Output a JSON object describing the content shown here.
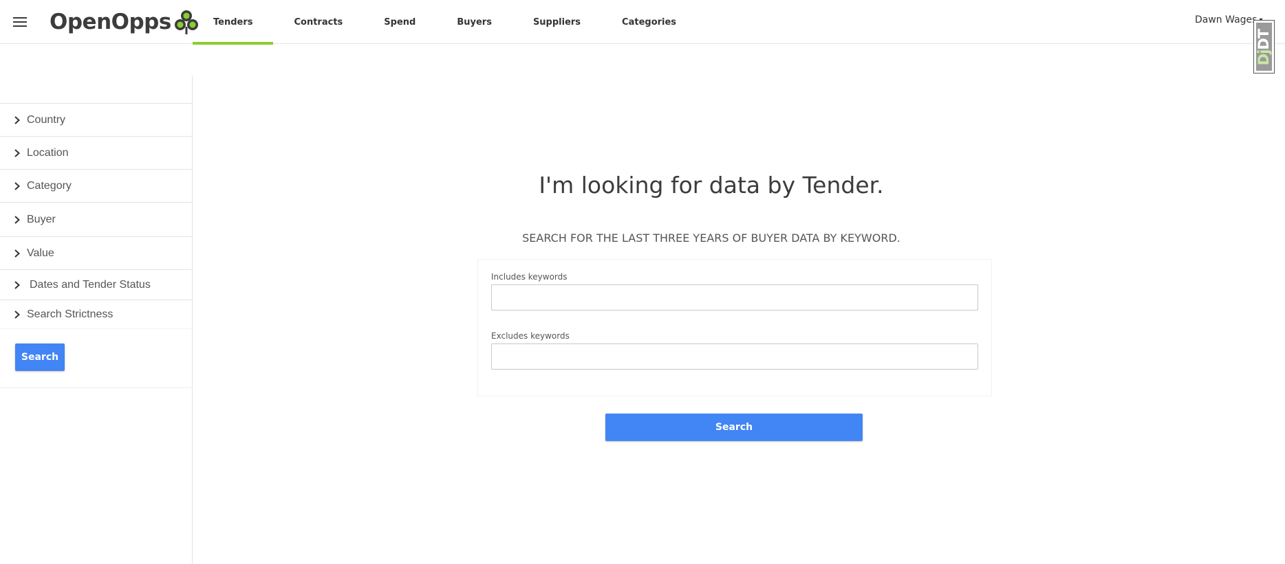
{
  "header": {
    "menu_icon": "hamburger-menu-icon",
    "logo_text": "OpenOpps",
    "logo_icon": "clover-logo-icon",
    "logo_colors": {
      "dark": "#3c3c3c",
      "green": "#8ccd2e"
    },
    "tabs": [
      {
        "label": "Tenders",
        "active": true
      },
      {
        "label": "Contracts",
        "active": false
      },
      {
        "label": "Spend",
        "active": false
      },
      {
        "label": "Buyers",
        "active": false
      },
      {
        "label": "Suppliers",
        "active": false
      },
      {
        "label": "Categories",
        "active": false
      }
    ],
    "active_tab_color": "#8ccd2e",
    "user_name": "Dawn Wages",
    "user_caret_icon": "chevron-down-icon",
    "debug_badge": {
      "text": "DjDT",
      "icon": "django-debug-toolbar-icon"
    }
  },
  "sidebar": {
    "filters": [
      {
        "label": "Country",
        "icon": "chevron-right-icon"
      },
      {
        "label": "Location",
        "icon": "chevron-right-icon"
      },
      {
        "label": "Category",
        "icon": "chevron-right-icon"
      },
      {
        "label": "Buyer",
        "icon": "chevron-right-icon"
      },
      {
        "label": "Value",
        "icon": "chevron-right-icon"
      },
      {
        "label": "Dates and Tender Status",
        "icon": "chevron-right-icon"
      },
      {
        "label": "Search Strictness",
        "icon": "chevron-right-icon"
      }
    ],
    "search_label": "Search"
  },
  "main": {
    "headline": "I'm looking for data by Tender.",
    "subheading": "SEARCH FOR THE LAST THREE YEARS OF BUYER DATA BY KEYWORD.",
    "includes_label": "Includes keywords",
    "includes_value": "",
    "excludes_label": "Excludes keywords",
    "excludes_value": "",
    "search_label": "Search",
    "button_color": "#4285f4"
  }
}
